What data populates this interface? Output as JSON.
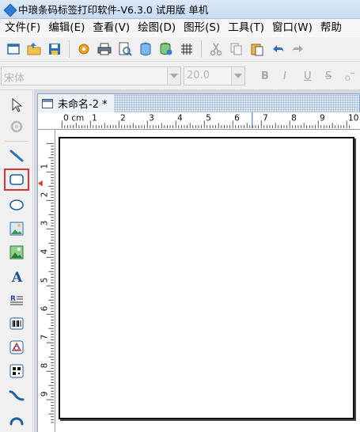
{
  "window": {
    "title": "中琅条码标签打印软件-V6.3.0 试用版 单机"
  },
  "menu": [
    "文件(F)",
    "编辑(E)",
    "查看(V)",
    "绘图(D)",
    "图形(S)",
    "工具(T)",
    "窗口(W)",
    "帮助"
  ],
  "font": {
    "family": "宋体",
    "size": "20.0"
  },
  "format_buttons": [
    "B",
    "I",
    "U",
    "S"
  ],
  "document": {
    "tab_label": "未命名-2 *"
  },
  "ruler": {
    "unit": "cm",
    "h_labels": [
      "0",
      "1",
      "2",
      "3",
      "4",
      "5",
      "6",
      "7",
      "8",
      "9",
      "10"
    ],
    "v_labels": [
      "1",
      "2",
      "3",
      "4",
      "5",
      "6",
      "7",
      "8",
      "9",
      "10"
    ]
  },
  "tools": {
    "selected": "rectangle-tool"
  },
  "colors": {
    "highlight": "#e03030",
    "accent": "#2d7fd3"
  }
}
